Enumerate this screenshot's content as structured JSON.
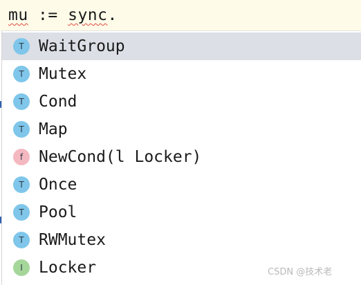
{
  "editor": {
    "code_var": "mu",
    "code_op": " := ",
    "code_pkg": "sync",
    "code_dot": "."
  },
  "completion": {
    "items": [
      {
        "label": "WaitGroup",
        "kind": "T",
        "selected": true
      },
      {
        "label": "Mutex",
        "kind": "T"
      },
      {
        "label": "Cond",
        "kind": "T"
      },
      {
        "label": "Map",
        "kind": "T"
      },
      {
        "label": "NewCond(l Locker)",
        "kind": "f"
      },
      {
        "label": "Once",
        "kind": "T"
      },
      {
        "label": "Pool",
        "kind": "T"
      },
      {
        "label": "RWMutex",
        "kind": "T"
      },
      {
        "label": "Locker",
        "kind": "I"
      }
    ]
  },
  "watermark": "CSDN @技术老"
}
